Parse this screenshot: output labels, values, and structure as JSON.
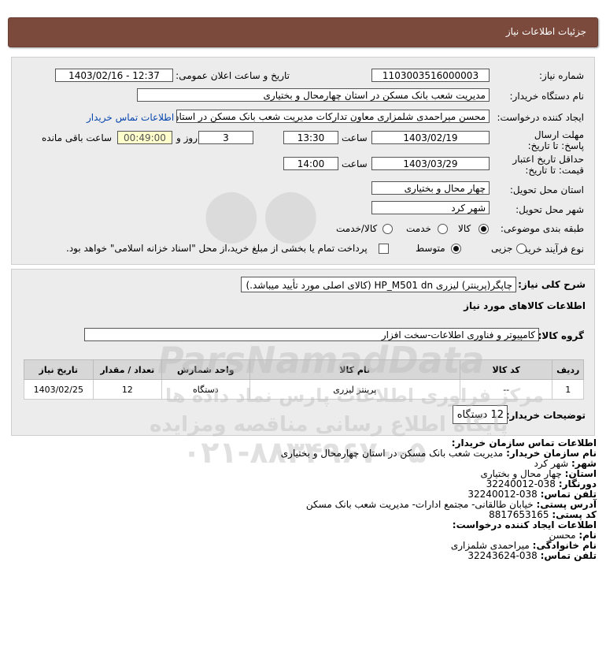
{
  "header": {
    "title": "جزئیات اطلاعات نیاز"
  },
  "form": {
    "need_number_label": "شماره نیاز:",
    "need_number": "1103003516000003",
    "announce_label": "تاریخ و ساعت اعلان عمومی:",
    "announce_value": "1403/02/16 - 12:37",
    "buyer_org_label": "نام دستگاه خریدار:",
    "buyer_org": "مدیریت شعب بانک مسکن در استان چهارمحال و بختیاری",
    "creator_label": "ایجاد کننده درخواست:",
    "creator": "محسن  میراحمدی شلمزاری  معاون تدارکات  مدیریت شعب بانک مسکن در استان",
    "contact_link": "اطلاعات تماس خریدار",
    "deadline_label": "مهلت ارسال پاسخ: تا تاریخ:",
    "deadline_date": "1403/02/19",
    "time_label": "ساعت",
    "deadline_time": "13:30",
    "days_value": "3",
    "days_label": "روز و",
    "remaining_time": "00:49:00",
    "remaining_label": "ساعت باقی مانده",
    "validity_label": "حداقل تاریخ اعتبار قیمت: تا تاریخ:",
    "validity_date": "1403/03/29",
    "validity_time": "14:00",
    "province_label": "استان محل تحویل:",
    "province": "چهار محال و بختیاری",
    "city_label": "شهر محل تحویل:",
    "city": "شهر کرد",
    "category_label": "طبقه بندی موضوعی:",
    "category_options": [
      "کالا",
      "خدمت",
      "کالا/خدمت"
    ],
    "process_label": "نوع فرآیند خرید :",
    "process_options": [
      "جزیی",
      "متوسط"
    ],
    "payment_note": "پرداخت تمام یا بخشی از مبلغ خرید،از محل \"اسناد خزانه اسلامی\" خواهد بود."
  },
  "need": {
    "desc_label": "شرح کلی نیاز:",
    "desc": "چاپگر(پرینتر) لیزری HP_M501 dn (کالای اصلی مورد تأیید میباشد.)",
    "goods_title": "اطلاعات کالاهای مورد نیاز",
    "group_label": "گروه کالا:",
    "group": "کامپیوتر و فناوری اطلاعات-سخت افزار",
    "columns": [
      "ردیف",
      "کد کالا",
      "نام کالا",
      "واحد شمارش",
      "تعداد / مقدار",
      "تاریخ نیاز"
    ],
    "rows": [
      {
        "row": "1",
        "code": "--",
        "name": "پرینتر لیزری",
        "unit": "دستگاه",
        "qty": "12",
        "date": "1403/02/25"
      }
    ],
    "buyer_notes_label": "توضیحات خریدار:",
    "buyer_notes": "12 دستگاه"
  },
  "contact": {
    "title": "اطلاعات تماس سازمان خریدار:",
    "org_label": "نام سازمان خریدار:",
    "org": "مدیریت شعب بانک مسکن در استان چهارمحال و بختیاری",
    "city_label": "شهر:",
    "city": "شهر کرد",
    "province_label": "استان:",
    "province": "چهار محال و بختیاری",
    "fax_label": "دورنگار:",
    "fax": "038-32240012",
    "phone_label": "تلفن تماس:",
    "phone": "038-32240012",
    "address_label": "آدرس پستی:",
    "address": "خیابان طالقانی- مجتمع ادارات- مدیریت شعب بانک مسکن",
    "postal_label": "کد پستی:",
    "postal": "8817653165",
    "creator_title": "اطلاعات ایجاد کننده درخواست:",
    "name_label": "نام:",
    "name": "محسن",
    "family_label": "نام خانوادگی:",
    "family": "میراحمدی شلمزاری",
    "creator_phone_label": "تلفن تماس:",
    "creator_phone": "038-32243624"
  },
  "watermark": {
    "logo": "ParsNamadData",
    "line1": "مرکز فراوری اطلاعات پارس نماد داده ها",
    "line2": "پایگاه اطلاع رسانی مناقصه ومزایده",
    "phone": "۰۲۱-۸۸۳۴۹۶۷۰-۵"
  }
}
